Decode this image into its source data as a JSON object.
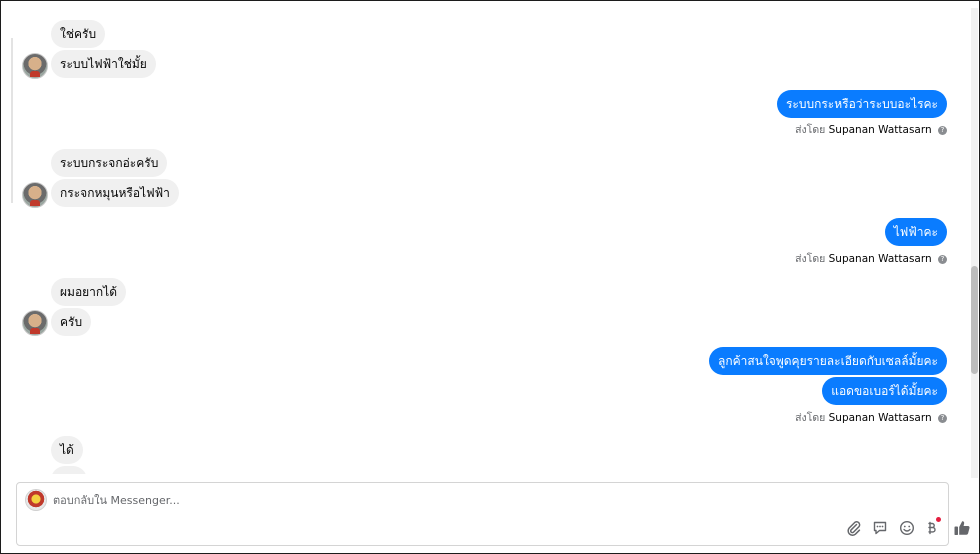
{
  "conversation": {
    "messages": [
      {
        "side": "in",
        "text": "ใช่ครับ"
      },
      {
        "side": "in",
        "text": "ระบบไฟฟ้าใช่มั้ย"
      },
      {
        "side": "out",
        "text": "ระบบกระหรือว่าระบบอะไรคะ"
      },
      {
        "side": "in",
        "text": "ระบบกระจกอ่ะครับ"
      },
      {
        "side": "in",
        "text": "กระจกหมุนหรือไฟฟ้า"
      },
      {
        "side": "out",
        "text": "ไฟฟ้าคะ"
      },
      {
        "side": "in",
        "text": "ผมอยากได้"
      },
      {
        "side": "in",
        "text": "ครับ"
      },
      {
        "side": "out",
        "text": "ลูกค้าสนใจพูดคุยรายละเอียดกับเซลล์มั้ยคะ"
      },
      {
        "side": "out",
        "text": "แอดขอเบอร์ได้มั้ยคะ"
      },
      {
        "side": "in",
        "text": "ได้"
      }
    ],
    "sent_by": {
      "prefix": "ส่งโดย",
      "name": "Supanan Wattasarn",
      "help_glyph": "?"
    }
  },
  "composer": {
    "placeholder": "ตอบกลับใน Messenger...",
    "tools": [
      "paperclip-icon",
      "saved-reply-icon",
      "emoji-icon",
      "payment-icon",
      "thumbs-up-icon"
    ]
  },
  "colors": {
    "outgoing_bubble": "#0a7cff",
    "incoming_bubble": "#f0f0f0",
    "icon": "#65676b",
    "notification_dot": "#e41e3f"
  }
}
